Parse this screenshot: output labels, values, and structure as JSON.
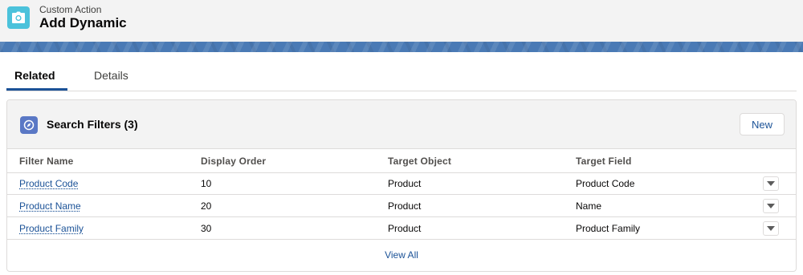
{
  "header": {
    "subtitle": "Custom Action",
    "title": "Add Dynamic",
    "icon": "camera-icon",
    "icon_color": "#4bc2db"
  },
  "tabs": [
    {
      "label": "Related",
      "active": true
    },
    {
      "label": "Details",
      "active": false
    }
  ],
  "card": {
    "title": "Search Filters (3)",
    "icon": "compass-icon",
    "icon_color": "#5a78c5",
    "new_label": "New",
    "columns": [
      "Filter Name",
      "Display Order",
      "Target Object",
      "Target Field"
    ],
    "rows": [
      {
        "name": "Product Code",
        "order": "10",
        "object": "Product",
        "field": "Product Code"
      },
      {
        "name": "Product Name",
        "order": "20",
        "object": "Product",
        "field": "Name"
      },
      {
        "name": "Product Family",
        "order": "30",
        "object": "Product",
        "field": "Product Family"
      }
    ],
    "view_all": "View All",
    "row_action_icon": "chevron-down-icon"
  },
  "colors": {
    "link": "#1b5297",
    "banner": "#4a7ab5",
    "header_bg": "#f3f3f3"
  }
}
